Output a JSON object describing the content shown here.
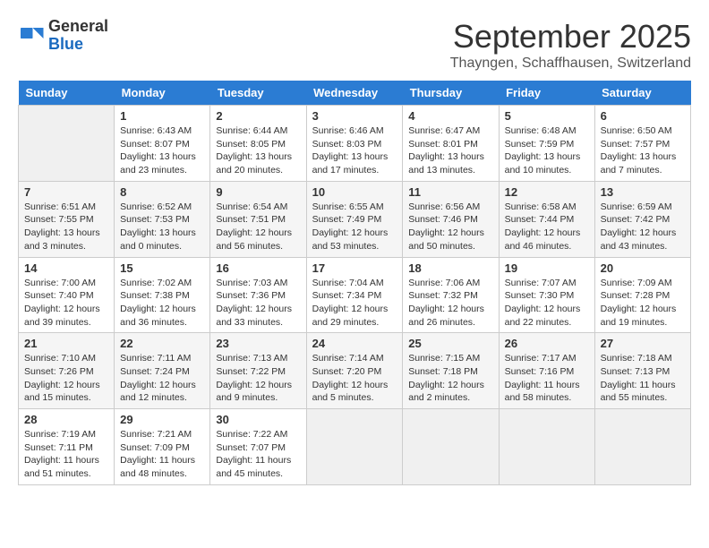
{
  "header": {
    "logo_general": "General",
    "logo_blue": "Blue",
    "month_title": "September 2025",
    "location": "Thayngen, Schaffhausen, Switzerland"
  },
  "days_of_week": [
    "Sunday",
    "Monday",
    "Tuesday",
    "Wednesday",
    "Thursday",
    "Friday",
    "Saturday"
  ],
  "weeks": [
    [
      {
        "day": "",
        "info": ""
      },
      {
        "day": "1",
        "info": "Sunrise: 6:43 AM\nSunset: 8:07 PM\nDaylight: 13 hours and 23 minutes."
      },
      {
        "day": "2",
        "info": "Sunrise: 6:44 AM\nSunset: 8:05 PM\nDaylight: 13 hours and 20 minutes."
      },
      {
        "day": "3",
        "info": "Sunrise: 6:46 AM\nSunset: 8:03 PM\nDaylight: 13 hours and 17 minutes."
      },
      {
        "day": "4",
        "info": "Sunrise: 6:47 AM\nSunset: 8:01 PM\nDaylight: 13 hours and 13 minutes."
      },
      {
        "day": "5",
        "info": "Sunrise: 6:48 AM\nSunset: 7:59 PM\nDaylight: 13 hours and 10 minutes."
      },
      {
        "day": "6",
        "info": "Sunrise: 6:50 AM\nSunset: 7:57 PM\nDaylight: 13 hours and 7 minutes."
      }
    ],
    [
      {
        "day": "7",
        "info": "Sunrise: 6:51 AM\nSunset: 7:55 PM\nDaylight: 13 hours and 3 minutes."
      },
      {
        "day": "8",
        "info": "Sunrise: 6:52 AM\nSunset: 7:53 PM\nDaylight: 13 hours and 0 minutes."
      },
      {
        "day": "9",
        "info": "Sunrise: 6:54 AM\nSunset: 7:51 PM\nDaylight: 12 hours and 56 minutes."
      },
      {
        "day": "10",
        "info": "Sunrise: 6:55 AM\nSunset: 7:49 PM\nDaylight: 12 hours and 53 minutes."
      },
      {
        "day": "11",
        "info": "Sunrise: 6:56 AM\nSunset: 7:46 PM\nDaylight: 12 hours and 50 minutes."
      },
      {
        "day": "12",
        "info": "Sunrise: 6:58 AM\nSunset: 7:44 PM\nDaylight: 12 hours and 46 minutes."
      },
      {
        "day": "13",
        "info": "Sunrise: 6:59 AM\nSunset: 7:42 PM\nDaylight: 12 hours and 43 minutes."
      }
    ],
    [
      {
        "day": "14",
        "info": "Sunrise: 7:00 AM\nSunset: 7:40 PM\nDaylight: 12 hours and 39 minutes."
      },
      {
        "day": "15",
        "info": "Sunrise: 7:02 AM\nSunset: 7:38 PM\nDaylight: 12 hours and 36 minutes."
      },
      {
        "day": "16",
        "info": "Sunrise: 7:03 AM\nSunset: 7:36 PM\nDaylight: 12 hours and 33 minutes."
      },
      {
        "day": "17",
        "info": "Sunrise: 7:04 AM\nSunset: 7:34 PM\nDaylight: 12 hours and 29 minutes."
      },
      {
        "day": "18",
        "info": "Sunrise: 7:06 AM\nSunset: 7:32 PM\nDaylight: 12 hours and 26 minutes."
      },
      {
        "day": "19",
        "info": "Sunrise: 7:07 AM\nSunset: 7:30 PM\nDaylight: 12 hours and 22 minutes."
      },
      {
        "day": "20",
        "info": "Sunrise: 7:09 AM\nSunset: 7:28 PM\nDaylight: 12 hours and 19 minutes."
      }
    ],
    [
      {
        "day": "21",
        "info": "Sunrise: 7:10 AM\nSunset: 7:26 PM\nDaylight: 12 hours and 15 minutes."
      },
      {
        "day": "22",
        "info": "Sunrise: 7:11 AM\nSunset: 7:24 PM\nDaylight: 12 hours and 12 minutes."
      },
      {
        "day": "23",
        "info": "Sunrise: 7:13 AM\nSunset: 7:22 PM\nDaylight: 12 hours and 9 minutes."
      },
      {
        "day": "24",
        "info": "Sunrise: 7:14 AM\nSunset: 7:20 PM\nDaylight: 12 hours and 5 minutes."
      },
      {
        "day": "25",
        "info": "Sunrise: 7:15 AM\nSunset: 7:18 PM\nDaylight: 12 hours and 2 minutes."
      },
      {
        "day": "26",
        "info": "Sunrise: 7:17 AM\nSunset: 7:16 PM\nDaylight: 11 hours and 58 minutes."
      },
      {
        "day": "27",
        "info": "Sunrise: 7:18 AM\nSunset: 7:13 PM\nDaylight: 11 hours and 55 minutes."
      }
    ],
    [
      {
        "day": "28",
        "info": "Sunrise: 7:19 AM\nSunset: 7:11 PM\nDaylight: 11 hours and 51 minutes."
      },
      {
        "day": "29",
        "info": "Sunrise: 7:21 AM\nSunset: 7:09 PM\nDaylight: 11 hours and 48 minutes."
      },
      {
        "day": "30",
        "info": "Sunrise: 7:22 AM\nSunset: 7:07 PM\nDaylight: 11 hours and 45 minutes."
      },
      {
        "day": "",
        "info": ""
      },
      {
        "day": "",
        "info": ""
      },
      {
        "day": "",
        "info": ""
      },
      {
        "day": "",
        "info": ""
      }
    ]
  ]
}
